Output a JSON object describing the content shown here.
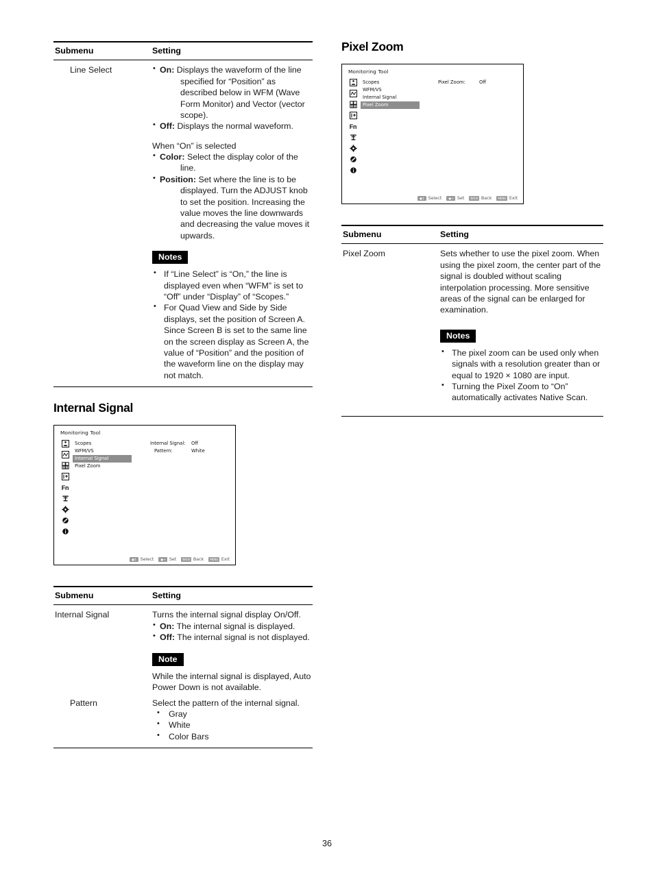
{
  "page": {
    "folio": "36"
  },
  "left_column": {
    "table_line_select": {
      "headers": {
        "submenu": "Submenu",
        "setting": "Setting"
      },
      "row_label": "Line Select",
      "bullets": [
        {
          "term": "On:",
          "text": "Displays the waveform of the line specified for “Position” as described below in WFM (Wave Form Monitor) and Vector (vector scope)."
        },
        {
          "term": "Off:",
          "text": "Displays the normal waveform."
        }
      ],
      "when_on_intro": "When “On” is selected",
      "bullets_when_on": [
        {
          "term": "Color:",
          "text": "Select the display color of the line."
        },
        {
          "term": "Position:",
          "text": "Set where the line is to be displayed. Turn the ADJUST knob to set the position. Increasing the value moves the line downwards and decreasing the value moves it upwards."
        }
      ],
      "notes_badge": "Notes",
      "notes": [
        "If “Line Select” is “On,” the line is displayed even when “WFM” is set to “Off” under “Display” of “Scopes.”",
        "For Quad View and Side by Side displays, set the position of Screen A. Since Screen B is set to the same line on the screen display as Screen A, the value of “Position” and the position of the waveform line on the display may not match."
      ]
    },
    "internal_signal_heading": "Internal Signal",
    "osd_internal_signal": {
      "title": "Monitoring Tool",
      "icons": [
        "user-icon",
        "waveform-icon",
        "grid-icon",
        "input-icon",
        "fn-icon",
        "anchor-icon",
        "gear-icon",
        "prohibited-icon",
        "info-icon"
      ],
      "icon_fn_label": "Fn",
      "menu_items": [
        {
          "label": "Scopes",
          "selected": false
        },
        {
          "label": "WFM/VS",
          "selected": false
        },
        {
          "label": "Internal Signal",
          "selected": true
        },
        {
          "label": "Pixel Zoom",
          "selected": false
        }
      ],
      "values": [
        {
          "label": "Internal Signal:",
          "value": "Off",
          "indent": false
        },
        {
          "label": "Pattern:",
          "value": "White",
          "indent": true
        }
      ],
      "statusbar": [
        {
          "key": "●↕",
          "label": "Select"
        },
        {
          "key": "●→",
          "label": "Set"
        },
        {
          "key": "BACK",
          "label": "Back"
        },
        {
          "key": "MENU",
          "label": "Exit"
        }
      ]
    },
    "table_internal_signal": {
      "headers": {
        "submenu": "Submenu",
        "setting": "Setting"
      },
      "rows": [
        {
          "label": "Internal Signal",
          "intro": "Turns the internal signal display On/Off.",
          "bullets": [
            {
              "term": "On:",
              "text": "The internal signal is displayed."
            },
            {
              "term": "Off:",
              "text": "The internal signal is not displayed."
            }
          ],
          "note_badge": "Note",
          "note_text": "While the internal signal is displayed, Auto Power Down is not available."
        },
        {
          "label": "Pattern",
          "intro": "Select the pattern of the internal signal.",
          "options": [
            "Gray",
            "White",
            "Color Bars"
          ]
        }
      ]
    }
  },
  "right_column": {
    "pixel_zoom_heading": "Pixel Zoom",
    "osd_pixel_zoom": {
      "title": "Monitoring Tool",
      "icons": [
        "user-icon",
        "waveform-icon",
        "grid-icon",
        "input-icon",
        "fn-icon",
        "anchor-icon",
        "gear-icon",
        "prohibited-icon",
        "info-icon"
      ],
      "icon_fn_label": "Fn",
      "menu_items": [
        {
          "label": "Scopes",
          "selected": false
        },
        {
          "label": "WFM/VS",
          "selected": false
        },
        {
          "label": "Internal Signal",
          "selected": false
        },
        {
          "label": "Pixel Zoom",
          "selected": true
        }
      ],
      "values": [
        {
          "label": "Pixel Zoom:",
          "value": "Off",
          "indent": false
        }
      ],
      "statusbar": [
        {
          "key": "●↕",
          "label": "Select"
        },
        {
          "key": "●→",
          "label": "Set"
        },
        {
          "key": "BACK",
          "label": "Back"
        },
        {
          "key": "MENU",
          "label": "Exit"
        }
      ]
    },
    "table_pixel_zoom": {
      "headers": {
        "submenu": "Submenu",
        "setting": "Setting"
      },
      "row_label": "Pixel Zoom",
      "description": "Sets whether to use the pixel zoom. When using the pixel zoom, the center part of the signal is doubled without scaling interpolation processing. More sensitive areas of the signal can be enlarged for examination.",
      "notes_badge": "Notes",
      "notes": [
        "The pixel zoom can be used only when signals with a resolution greater than or equal to 1920 × 1080 are input.",
        "Turning the Pixel Zoom to “On” automatically activates Native Scan."
      ]
    }
  },
  "colors": {
    "rule": "#000000",
    "badge_bg": "#000000",
    "badge_fg": "#ffffff",
    "osd_highlight": "#8d8d8d",
    "osd_key": "#9a9a9a"
  }
}
